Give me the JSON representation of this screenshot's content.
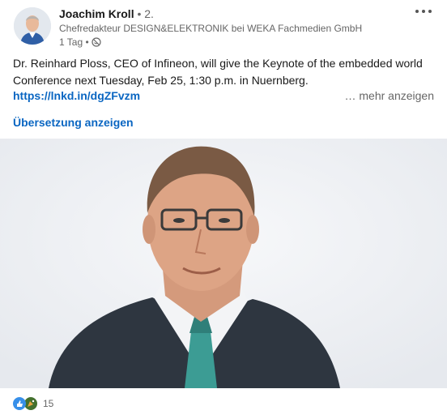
{
  "header": {
    "author_name": "Joachim Kroll",
    "degree": "• 2.",
    "author_title": "Chefredakteur DESIGN&ELEKTRONIK bei WEKA Fachmedien GmbH",
    "time": "1 Tag •",
    "visibility_icon": "globe-icon",
    "menu_icon": "more-icon"
  },
  "post": {
    "text": "Dr. Reinhard Ploss, CEO of Infineon, will give the Keynote of the embedded world Conference next Tuesday, Feb 25, 1:30 p.m. in Nuernberg.",
    "link": "https://lnkd.in/dgZFvzm",
    "see_more": "… mehr anzeigen",
    "translate": "Übersetzung anzeigen"
  },
  "reactions": {
    "icons": [
      "like-icon",
      "celebrate-icon"
    ],
    "count": "15"
  },
  "colors": {
    "link_blue": "#0a66c2",
    "secondary_text": "#666666",
    "like_blue": "#378fe9",
    "celebrate_green": "#44712e"
  }
}
